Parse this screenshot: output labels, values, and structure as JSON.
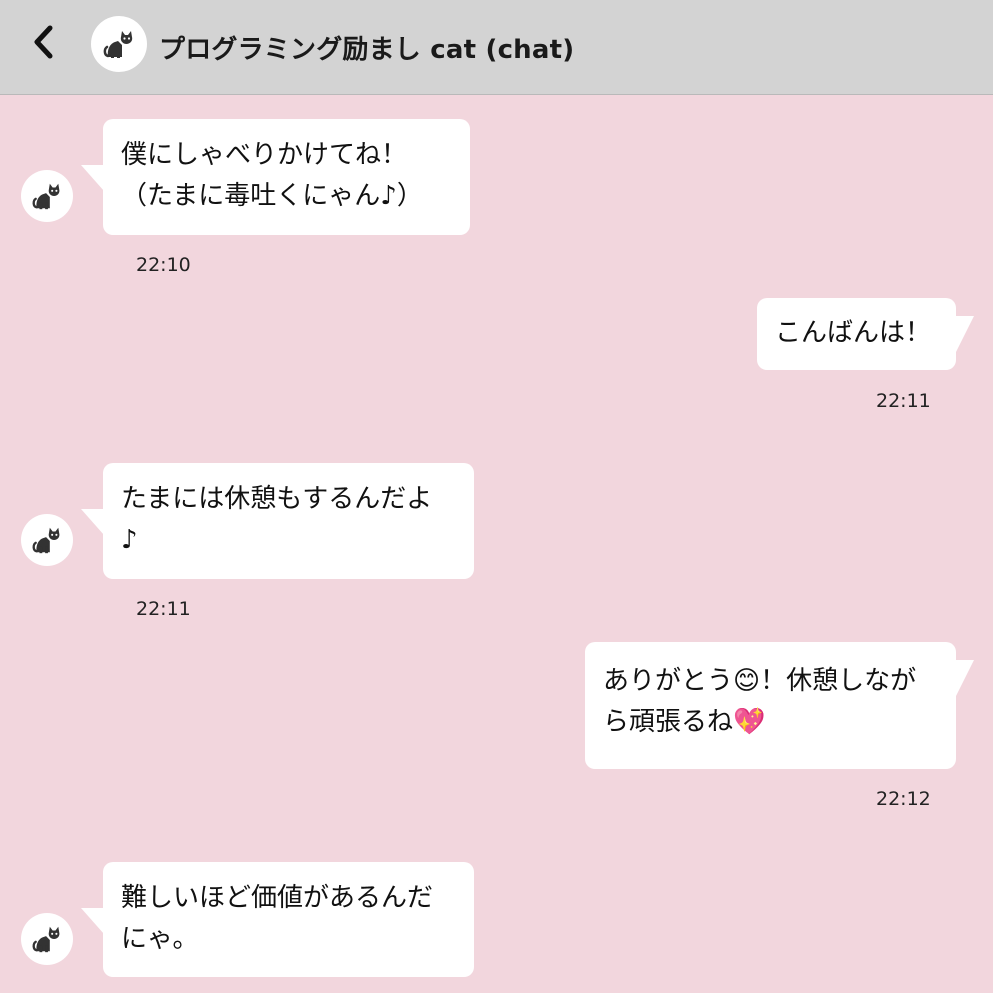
{
  "header": {
    "title": "プログラミング励まし cat (chat)",
    "back_icon": "chevron-left-icon",
    "avatar_icon": "black-cat-icon"
  },
  "messages": [
    {
      "sender": "cat",
      "lines": [
        "僕にしゃべりかけてね！",
        "（たまに毒吐くにゃん♪）"
      ],
      "time": "22:10"
    },
    {
      "sender": "user",
      "lines": [
        "こんばんは！"
      ],
      "time": "22:11"
    },
    {
      "sender": "cat",
      "lines": [
        "たまには休憩もするんだよ",
        "♪"
      ],
      "time": "22:11"
    },
    {
      "sender": "user",
      "lines": [
        "ありがとう😊！休憩しなが",
        "ら頑張るね💖"
      ],
      "time": "22:12"
    },
    {
      "sender": "cat",
      "lines": [
        "難しいほど価値があるんだ",
        "にゃ。"
      ],
      "time": ""
    }
  ],
  "colors": {
    "background": "#f2d6dd",
    "header": "#d3d3d3",
    "bubble": "#ffffff"
  }
}
